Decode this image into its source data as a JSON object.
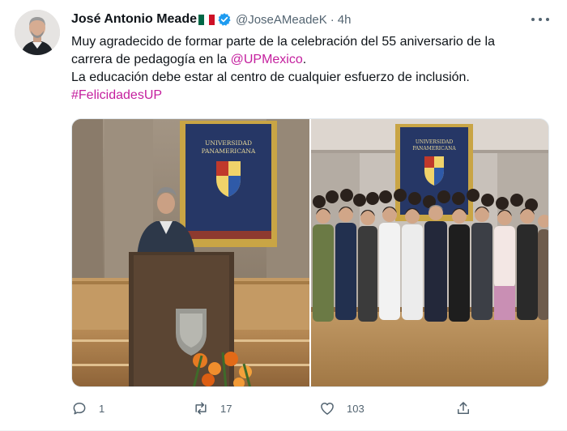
{
  "author": {
    "name": "José Antonio Meade",
    "handle": "@JoseAMeadeK",
    "time": "4h",
    "separator": "·"
  },
  "tweet": {
    "line1": "Muy agradecido de formar parte de la celebración del 55 aniversario de la",
    "line2_prefix": "carrera de pedagogía en la ",
    "mention": "@UPMexico",
    "line2_suffix": ".",
    "line3": "La educación debe estar al centro de cualquier esfuerzo de inclusión.",
    "hashtag": "#FelicidadesUP"
  },
  "banner": {
    "line1": "UNIVERSIDAD",
    "line2": "PANAMERICANA"
  },
  "actions": {
    "replies": "1",
    "retweets": "17",
    "likes": "103"
  },
  "colors": {
    "link": "#c41f9e",
    "verified": "#1d9bf0",
    "secondary_text": "#536471"
  },
  "icons": {
    "more": "three-dots-icon",
    "reply": "speech-bubble-icon",
    "retweet": "retweet-arrows-icon",
    "like": "heart-icon",
    "share": "share-upload-icon",
    "verified": "verified-badge-icon",
    "flag": "mexico-flag-icon"
  }
}
